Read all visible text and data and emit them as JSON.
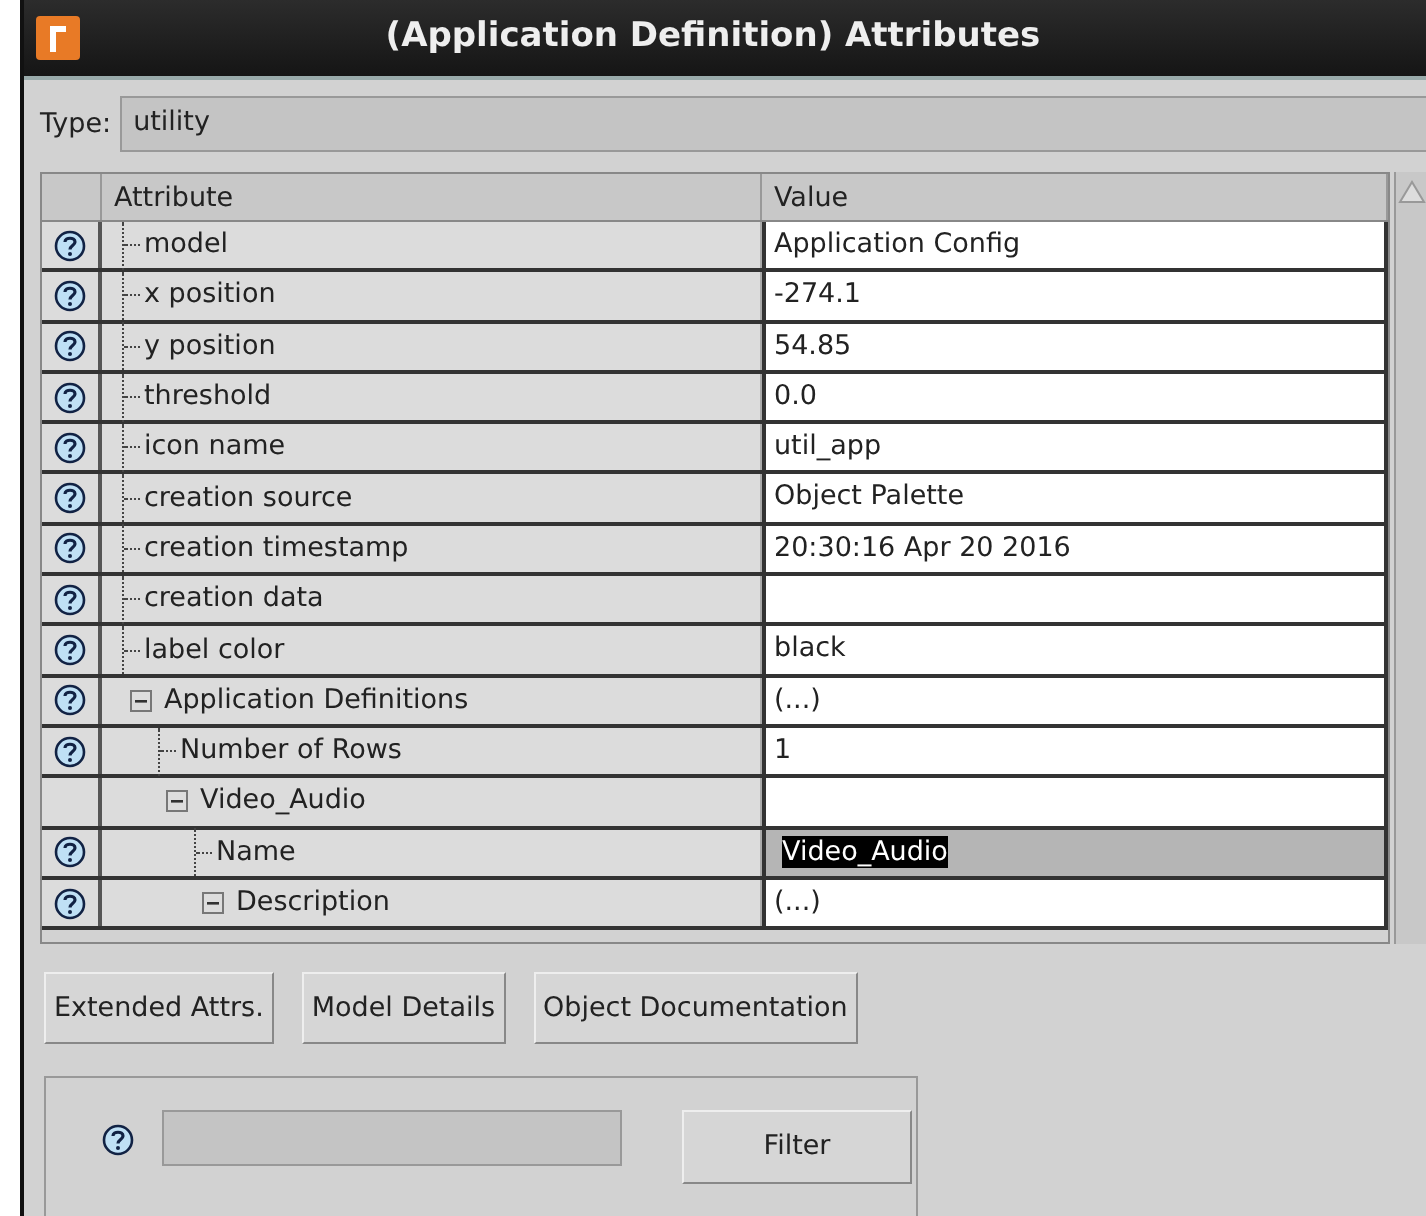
{
  "window": {
    "title": "(Application Definition) Attributes"
  },
  "type": {
    "label": "Type:",
    "value": "utility"
  },
  "table": {
    "columns": [
      "Attribute",
      "Value"
    ],
    "rows": [
      {
        "attribute": "model",
        "value": "Application Config",
        "help": true,
        "selected": false
      },
      {
        "attribute": "x position",
        "value": "-274.1",
        "help": true,
        "selected": false
      },
      {
        "attribute": "y position",
        "value": "54.85",
        "help": true,
        "selected": false
      },
      {
        "attribute": "threshold",
        "value": "0.0",
        "help": true,
        "selected": false
      },
      {
        "attribute": "icon name",
        "value": "util_app",
        "help": true,
        "selected": false
      },
      {
        "attribute": "creation source",
        "value": "Object Palette",
        "help": true,
        "selected": false
      },
      {
        "attribute": "creation timestamp",
        "value": "20:30:16 Apr 20 2016",
        "help": true,
        "selected": false
      },
      {
        "attribute": "creation data",
        "help": true,
        "selected": false
      },
      {
        "attribute": "label color",
        "value": "black",
        "help": true,
        "selected": false
      },
      {
        "attribute": "Application Definitions",
        "value": "(...)",
        "help": true,
        "selected": false,
        "expanded": true,
        "children": [
          {
            "attribute": "Number of Rows",
            "value": "1",
            "help": true,
            "selected": false
          },
          {
            "attribute": "Video_Audio",
            "help": false,
            "selected": false,
            "expanded": true,
            "children": [
              {
                "attribute": "Name",
                "value": "Video_Audio",
                "help": true,
                "selected": true
              },
              {
                "attribute": "Description",
                "value": "(...)",
                "help": true,
                "selected": false,
                "expanded": true
              }
            ]
          }
        ]
      }
    ]
  },
  "buttons": [
    {
      "label": "Extended Attrs."
    },
    {
      "label": "Model Details"
    },
    {
      "label": "Object Documentation"
    }
  ],
  "filter": {
    "button": {
      "label": "Filter"
    }
  }
}
